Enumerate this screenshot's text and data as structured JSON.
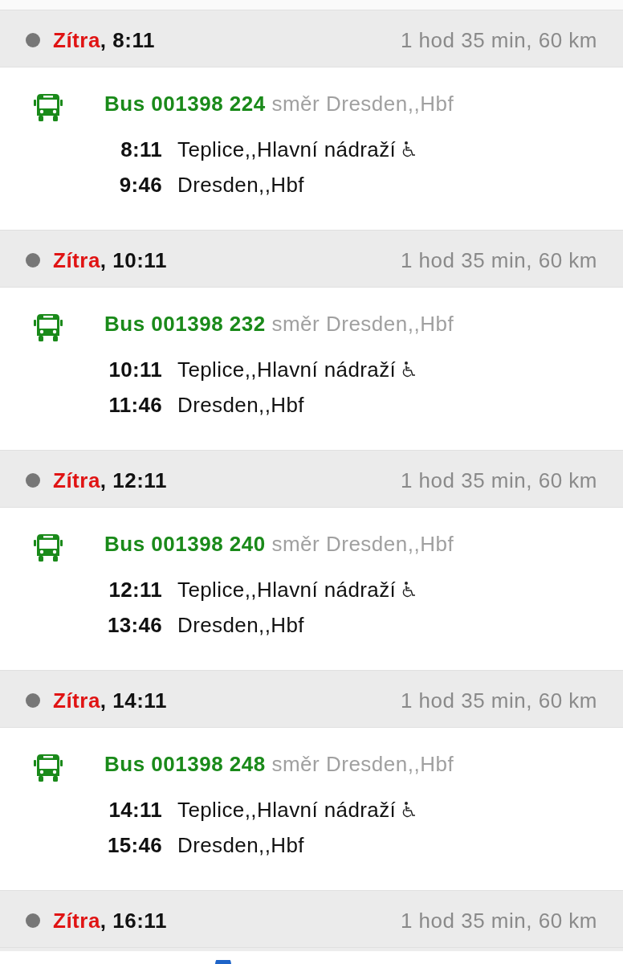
{
  "departures": [
    {
      "day": "Zítra",
      "time": ", 8:11",
      "duration": "1 hod 35 min, 60 km",
      "line": "Bus 001398 224",
      "direction": "směr Dresden,,Hbf",
      "stops": [
        {
          "time": "8:11",
          "name": "Teplice,,Hlavní nádraží",
          "wheelchair": true
        },
        {
          "time": "9:46",
          "name": "Dresden,,Hbf",
          "wheelchair": false
        }
      ]
    },
    {
      "day": "Zítra",
      "time": ", 10:11",
      "duration": "1 hod 35 min, 60 km",
      "line": "Bus 001398 232",
      "direction": "směr Dresden,,Hbf",
      "stops": [
        {
          "time": "10:11",
          "name": "Teplice,,Hlavní nádraží",
          "wheelchair": true
        },
        {
          "time": "11:46",
          "name": "Dresden,,Hbf",
          "wheelchair": false
        }
      ]
    },
    {
      "day": "Zítra",
      "time": ", 12:11",
      "duration": "1 hod 35 min, 60 km",
      "line": "Bus 001398 240",
      "direction": "směr Dresden,,Hbf",
      "stops": [
        {
          "time": "12:11",
          "name": "Teplice,,Hlavní nádraží",
          "wheelchair": true
        },
        {
          "time": "13:46",
          "name": "Dresden,,Hbf",
          "wheelchair": false
        }
      ]
    },
    {
      "day": "Zítra",
      "time": ", 14:11",
      "duration": "1 hod 35 min, 60 km",
      "line": "Bus 001398 248",
      "direction": "směr Dresden,,Hbf",
      "stops": [
        {
          "time": "14:11",
          "name": "Teplice,,Hlavní nádraží",
          "wheelchair": true
        },
        {
          "time": "15:46",
          "name": "Dresden,,Hbf",
          "wheelchair": false
        }
      ]
    },
    {
      "day": "Zítra",
      "time": ", 16:11",
      "duration": "1 hod 35 min, 60 km"
    }
  ]
}
